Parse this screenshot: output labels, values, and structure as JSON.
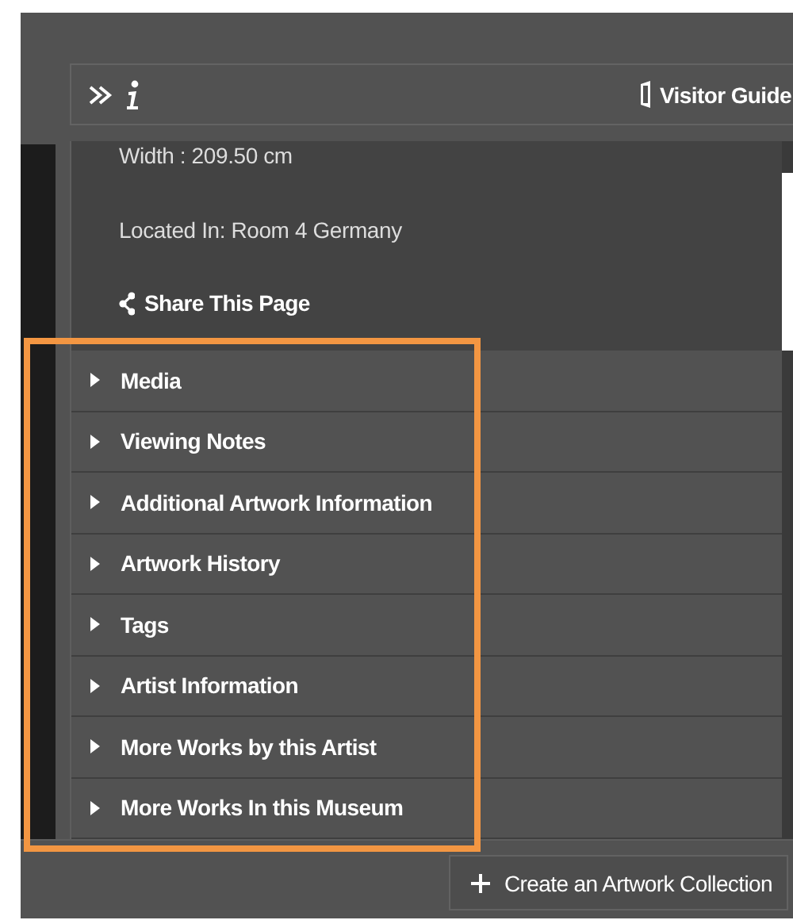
{
  "header": {
    "link": "Visitor Guide"
  },
  "details": {
    "lines": [
      "Width : 209.50 cm",
      "Located In: Room 4 Germany"
    ],
    "share": "Share This Page"
  },
  "sections": [
    {
      "label": "Media",
      "expanded": false
    },
    {
      "label": "Viewing Notes",
      "expanded": false
    },
    {
      "label": "Additional Artwork Information",
      "expanded": false
    },
    {
      "label": "Artwork History",
      "expanded": false
    },
    {
      "label": "Tags",
      "expanded": false
    },
    {
      "label": "Artist Information",
      "expanded": false
    },
    {
      "label": "More Works by this Artist",
      "expanded": false
    },
    {
      "label": "More Works In this Museum",
      "expanded": false
    }
  ],
  "highlight": {
    "on": true
  },
  "footer": {
    "button": "Create an Artwork Collection"
  }
}
